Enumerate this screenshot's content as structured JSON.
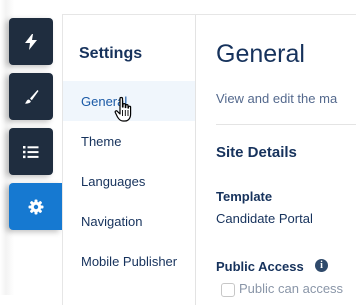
{
  "rail": {
    "buttons": [
      {
        "icon": "bolt-icon"
      },
      {
        "icon": "brush-icon"
      },
      {
        "icon": "list-icon"
      },
      {
        "icon": "gear-icon",
        "active": true
      }
    ]
  },
  "settings": {
    "title": "Settings",
    "items": [
      {
        "label": "General",
        "selected": true
      },
      {
        "label": "Theme"
      },
      {
        "label": "Languages"
      },
      {
        "label": "Navigation"
      },
      {
        "label": "Mobile Publisher"
      }
    ]
  },
  "main": {
    "title": "General",
    "subtitle": "View and edit the ma",
    "section_title": "Site Details",
    "template_label": "Template",
    "template_value": "Candidate Portal",
    "public_access_label": "Public Access",
    "public_access_checkbox_label": "Public can access"
  },
  "colors": {
    "rail_dark": "#1f2d3f",
    "rail_active": "#1679d1",
    "text_primary": "#16325c",
    "text_secondary": "#54698d"
  }
}
